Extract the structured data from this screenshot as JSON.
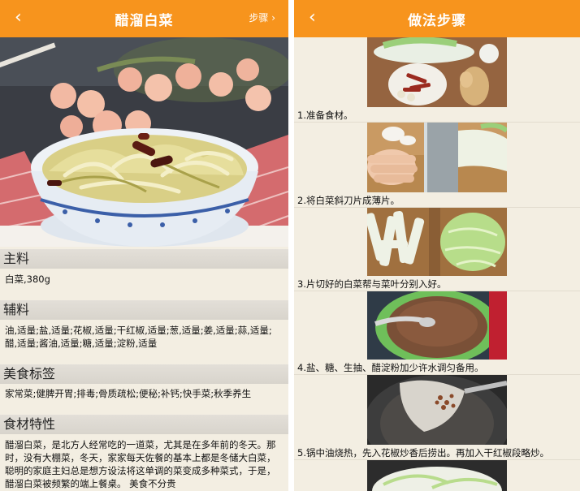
{
  "left": {
    "header": {
      "back_icon": "‹",
      "title": "醋溜白菜",
      "steps_link": "步骤 ›"
    },
    "main_ingredient": {
      "heading": "主料",
      "text": "白菜,380g"
    },
    "seasoning": {
      "heading": "辅料",
      "text": "油,适量;盐,适量;花椒,适量;干红椒,适量;葱,适量;姜,适量;蒜,适量;醋,适量;酱油,适量;糖,适量;淀粉,适量"
    },
    "tags": {
      "heading": "美食标签",
      "text": "家常菜;健脾开胃;排毒;骨质疏松;便秘;补钙;快手菜;秋季养生"
    },
    "features": {
      "heading": "食材特性",
      "text": "醋溜白菜，是北方人经常吃的一道菜，尤其是在多年前的冬天。那时，没有大棚菜，冬天，家家每天佐餐的基本上都是冬储大白菜，聪明的家庭主妇总是想方设法将这单调的菜变成多种菜式，于是，醋溜白菜被频繁的端上餐桌。 美食不分贵"
    }
  },
  "right": {
    "header": {
      "back_icon": "‹",
      "title": "做法步骤"
    },
    "steps": [
      {
        "text": "1.准备食材。"
      },
      {
        "text": "2.将白菜斜刀片成薄片。"
      },
      {
        "text": "3.片切好的白菜帮与菜叶分别入好。"
      },
      {
        "text": "4.盐、糖、生抽、醋淀粉加少许水调匀备用。"
      },
      {
        "text": "5.锅中油烧热，先入花椒炒香后捞出。再加入干红椒段略炒。"
      }
    ]
  },
  "colors": {
    "accent": "#f7941d",
    "section_bg": "#dcd8d0",
    "panel_bg": "#f3eee2"
  }
}
